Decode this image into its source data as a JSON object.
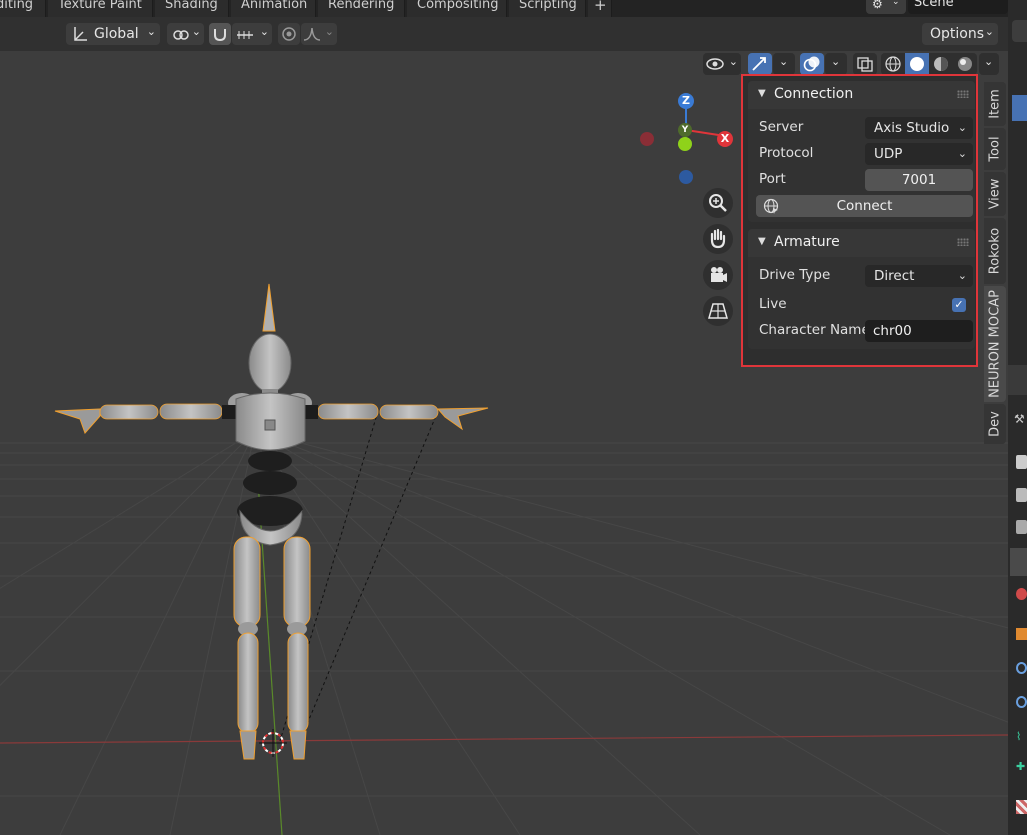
{
  "workspace_tabs": [
    "diting",
    "Texture Paint",
    "Shading",
    "Animation",
    "Rendering",
    "Compositing",
    "Scripting"
  ],
  "add_tab": "+",
  "scene_label": "Scene",
  "header": {
    "transform_orientation": "Global",
    "options_label": "Options"
  },
  "side_tabs": [
    "Item",
    "Tool",
    "View",
    "Rokoko",
    "NEURON MOCAP",
    "Dev"
  ],
  "connection": {
    "title": "Connection",
    "server_label": "Server",
    "server_value": "Axis Studio",
    "protocol_label": "Protocol",
    "protocol_value": "UDP",
    "port_label": "Port",
    "port_value": "7001",
    "connect_label": "Connect"
  },
  "armature": {
    "title": "Armature",
    "drive_type_label": "Drive Type",
    "drive_type_value": "Direct",
    "live_label": "Live",
    "live_checked": true,
    "character_name_label": "Character Name",
    "character_name_value": "chr00"
  },
  "gizmo": {
    "z": "Z",
    "y": "Y",
    "x": "X"
  },
  "colors": {
    "accent_blue": "#4772b3",
    "highlight_red": "#e0353a",
    "bone_orange": "#f0a030"
  }
}
